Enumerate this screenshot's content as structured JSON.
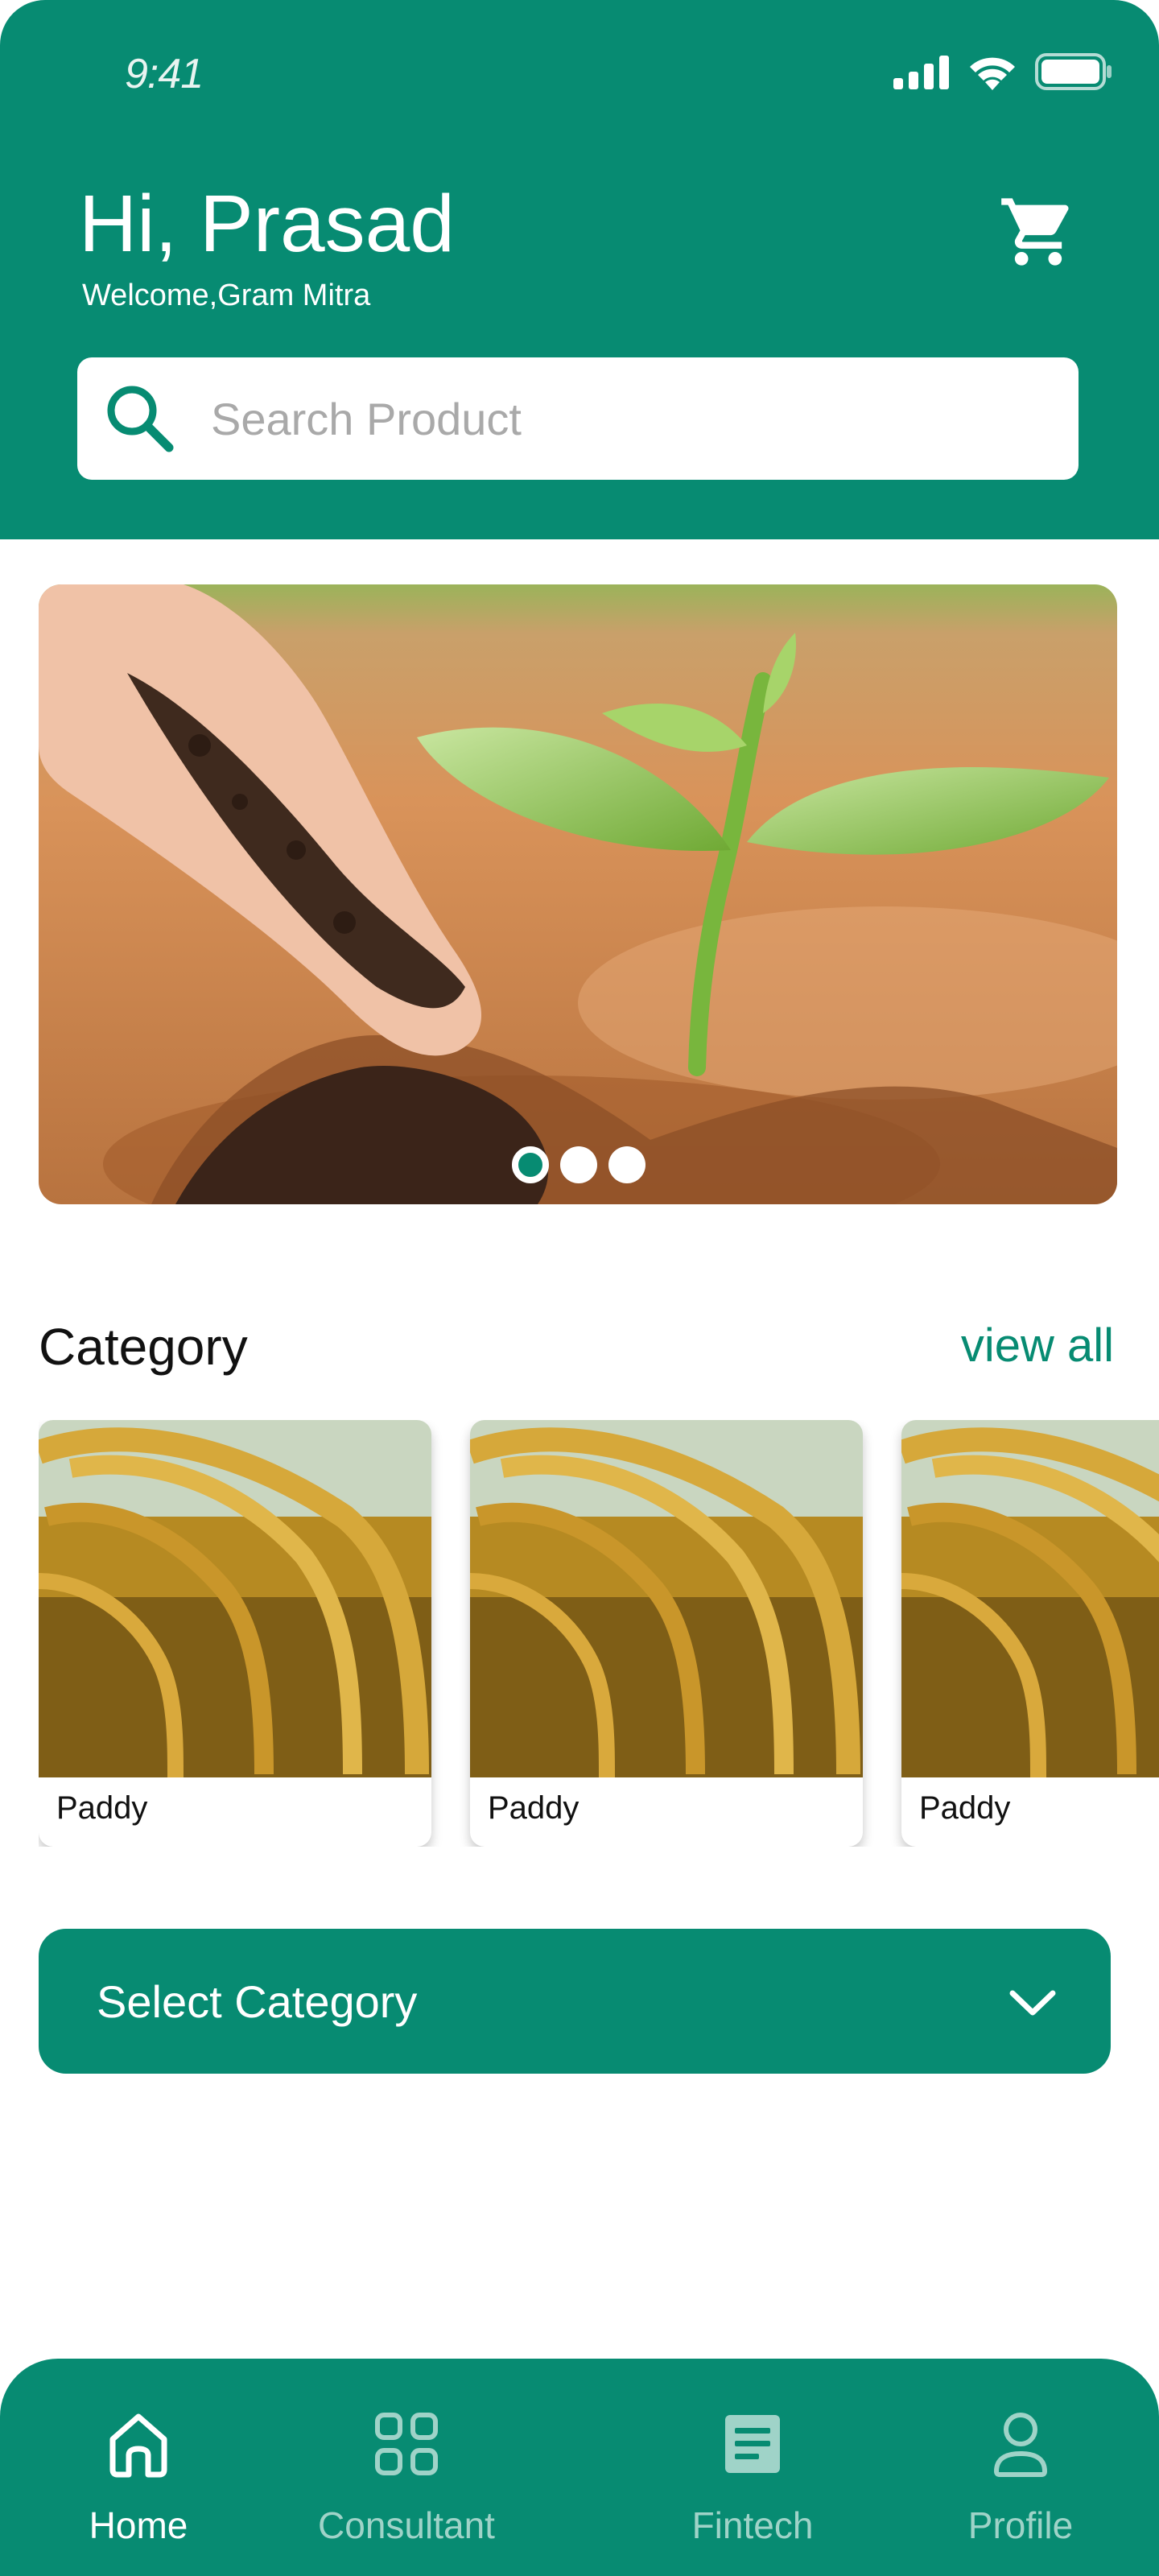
{
  "status_bar": {
    "time": "9:41"
  },
  "header": {
    "greeting": "Hi, Prasad",
    "subtitle": "Welcome,Gram Mitra"
  },
  "search": {
    "placeholder": "Search Product"
  },
  "banner": {
    "slide_count": 3,
    "active_slide": 1
  },
  "category": {
    "title": "Category",
    "view_all": "view all",
    "items": [
      {
        "label": "Paddy"
      },
      {
        "label": "Paddy"
      },
      {
        "label": "Paddy"
      }
    ]
  },
  "select_category": {
    "label": "Select Category"
  },
  "nav": {
    "items": [
      {
        "label": "Home",
        "icon": "home-icon",
        "active": true
      },
      {
        "label": "Consultant",
        "icon": "grid-icon",
        "active": false
      },
      {
        "label": "Fintech",
        "icon": "document-icon",
        "active": false
      },
      {
        "label": "Profile",
        "icon": "profile-icon",
        "active": false
      }
    ]
  },
  "colors": {
    "primary": "#078b72",
    "inactive_nav": "#9fd3c8",
    "white": "#ffffff"
  }
}
